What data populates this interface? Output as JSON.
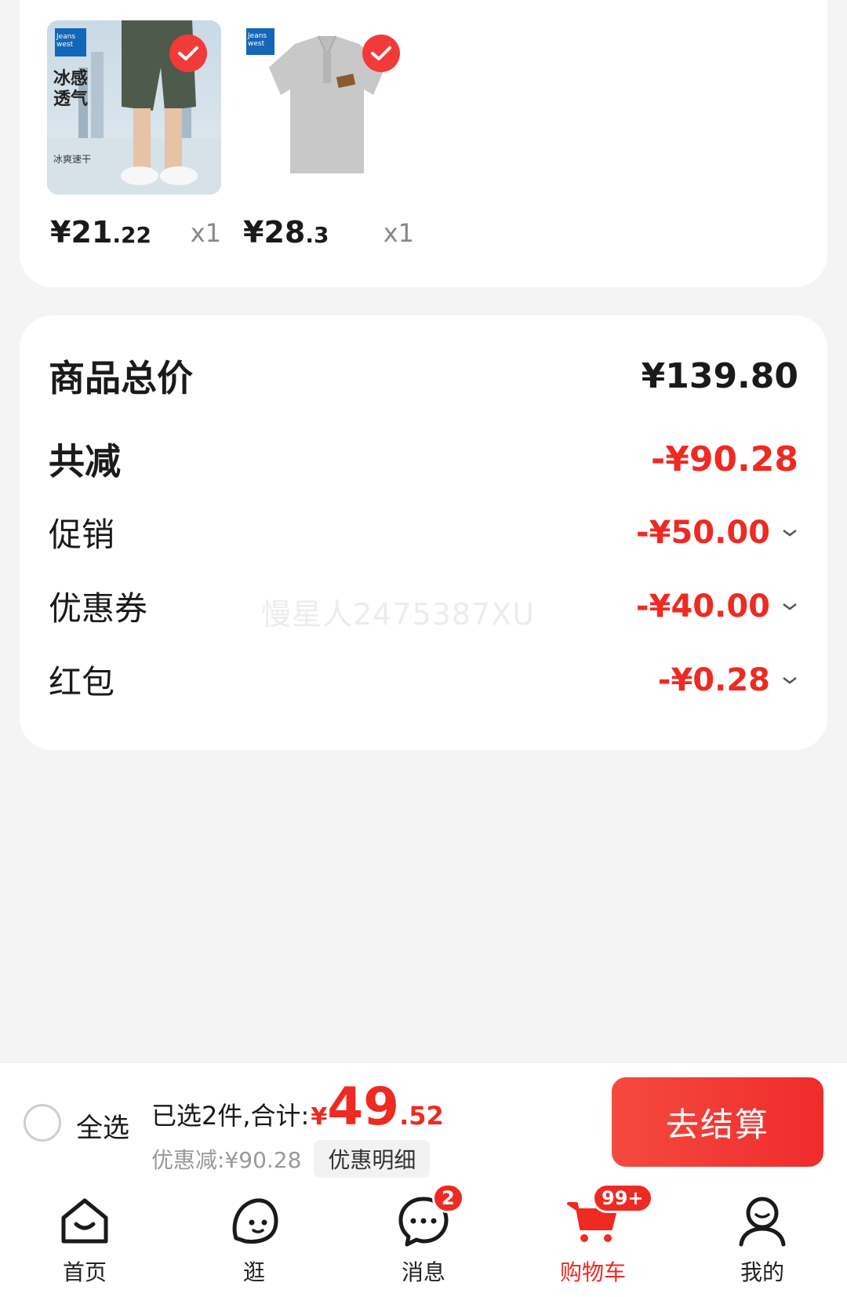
{
  "products": [
    {
      "price_int": "¥21",
      "price_dec": ".22",
      "qty": "x1",
      "thumb_text_1": "冰感",
      "thumb_text_2": "透气",
      "thumb_text_3": "冰爽速干",
      "brand": "Jeans west"
    },
    {
      "price_int": "¥28",
      "price_dec": ".3",
      "qty": "x1",
      "brand": "Jeans west"
    }
  ],
  "summary": {
    "total_label": "商品总价",
    "total_value": "¥139.80",
    "reduce_label": "共减",
    "reduce_value": "-¥90.28",
    "promo_label": "促销",
    "promo_value": "-¥50.00",
    "coupon_label": "优惠券",
    "coupon_value": "-¥40.00",
    "redpacket_label": "红包",
    "redpacket_value": "-¥0.28"
  },
  "watermark": "慢星人2475387XU",
  "checkout": {
    "select_all": "全选",
    "selected_text": "已选2件,合计:",
    "currency": "¥",
    "total_int": "49",
    "total_dec": ".52",
    "discount_text": "优惠减:¥90.28",
    "detail_button": "优惠明细",
    "pay_button": "去结算"
  },
  "tabs": [
    {
      "label": "首页",
      "icon": "home-icon"
    },
    {
      "label": "逛",
      "icon": "browse-icon"
    },
    {
      "label": "消息",
      "icon": "message-icon",
      "badge": "2"
    },
    {
      "label": "购物车",
      "icon": "cart-icon",
      "badge": "99+"
    },
    {
      "label": "我的",
      "icon": "profile-icon"
    }
  ],
  "colors": {
    "accent": "#ee2a22",
    "background": "#f4f4f4"
  }
}
